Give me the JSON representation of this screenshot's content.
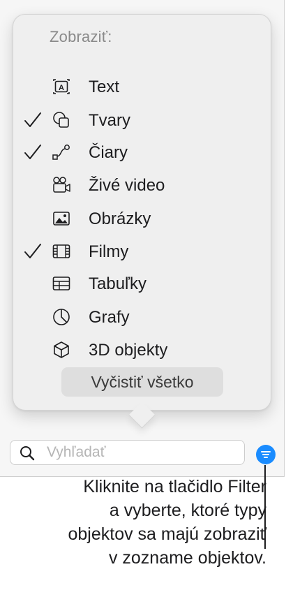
{
  "popover": {
    "title": "Zobraziť:",
    "items": [
      {
        "label": "Text",
        "checked": false,
        "icon": "text-box-icon"
      },
      {
        "label": "Tvary",
        "checked": true,
        "icon": "shapes-icon"
      },
      {
        "label": "Čiary",
        "checked": true,
        "icon": "lines-icon"
      },
      {
        "label": "Živé video",
        "checked": false,
        "icon": "live-video-icon"
      },
      {
        "label": "Obrázky",
        "checked": false,
        "icon": "images-icon"
      },
      {
        "label": "Filmy",
        "checked": true,
        "icon": "movies-icon"
      },
      {
        "label": "Tabuľky",
        "checked": false,
        "icon": "tables-icon"
      },
      {
        "label": "Grafy",
        "checked": false,
        "icon": "charts-icon"
      },
      {
        "label": "3D objekty",
        "checked": false,
        "icon": "3d-objects-icon"
      }
    ],
    "clear_label": "Vyčistiť všetko"
  },
  "search": {
    "placeholder": "Vyhľadať",
    "value": ""
  },
  "filter_button": {
    "icon": "filter-icon",
    "color": "#1a8cff"
  },
  "callout": {
    "lines": [
      "Kliknite na tlačidlo Filter",
      "a vyberte, ktoré typy",
      "objektov sa majú zobraziť",
      "v zozname objektov."
    ]
  }
}
